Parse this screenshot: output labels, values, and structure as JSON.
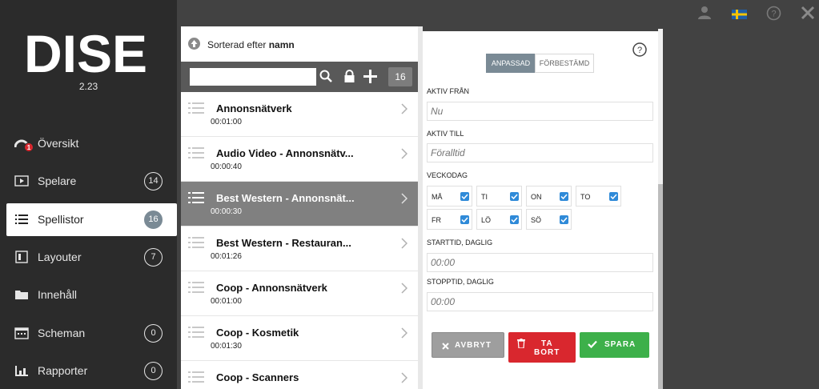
{
  "app": {
    "version": "2.23",
    "logo_text": "DISE"
  },
  "colors": {
    "accent": "#7a8a95",
    "delete": "#d9272e",
    "save": "#3db04a",
    "checkbox": "#2f8ad8"
  },
  "topbar": {
    "icons": [
      "user-icon",
      "swedish-flag-icon",
      "help-icon",
      "close-icon"
    ]
  },
  "sidebar": {
    "items": [
      {
        "label": "Översikt",
        "icon": "dashboard-icon",
        "alert": "1"
      },
      {
        "label": "Spelare",
        "icon": "player-icon",
        "count": "14"
      },
      {
        "label": "Spellistor",
        "icon": "list-icon",
        "count": "16",
        "active": true
      },
      {
        "label": "Layouter",
        "icon": "layout-icon",
        "count": "7"
      },
      {
        "label": "Innehåll",
        "icon": "folder-icon"
      },
      {
        "label": "Scheman",
        "icon": "calendar-icon",
        "count": "0"
      },
      {
        "label": "Rapporter",
        "icon": "report-icon",
        "count": "0"
      }
    ]
  },
  "playlists": {
    "sort_prefix": "Sorterad efter",
    "sort_key": "namn",
    "search_value": "",
    "count": "16",
    "items": [
      {
        "title": "Annonsnätverk",
        "duration": "00:01:00"
      },
      {
        "title": "Audio Video - Annonsnätv...",
        "duration": "00:00:40"
      },
      {
        "title": "Best Western - Annonsnät...",
        "duration": "00:00:30",
        "active": true
      },
      {
        "title": "Best Western - Restauran...",
        "duration": "00:01:26"
      },
      {
        "title": "Coop - Annonsnätverk",
        "duration": "00:01:00"
      },
      {
        "title": "Coop - Kosmetik",
        "duration": "00:01:30"
      },
      {
        "title": "Coop - Scanners",
        "duration": ""
      }
    ]
  },
  "schedule": {
    "mode_custom": "ANPASSAD",
    "mode_preset": "FÖRBESTÄMD",
    "active_from_label": "AKTIV FRÅN",
    "active_from_placeholder": "Nu",
    "active_to_label": "AKTIV TILL",
    "active_to_placeholder": "Föralltid",
    "weekday_label": "VECKODAG",
    "days": [
      "MÅ",
      "TI",
      "ON",
      "TO",
      "FR",
      "LÖ",
      "SÖ"
    ],
    "start_label": "STARTTID, DAGLIG",
    "start_placeholder": "00:00",
    "stop_label": "STOPPTID, DAGLIG",
    "stop_placeholder": "00:00",
    "cancel_label": "AVBRYT",
    "delete_label_1": "TA",
    "delete_label_2": "BORT",
    "save_label": "SPARA"
  }
}
